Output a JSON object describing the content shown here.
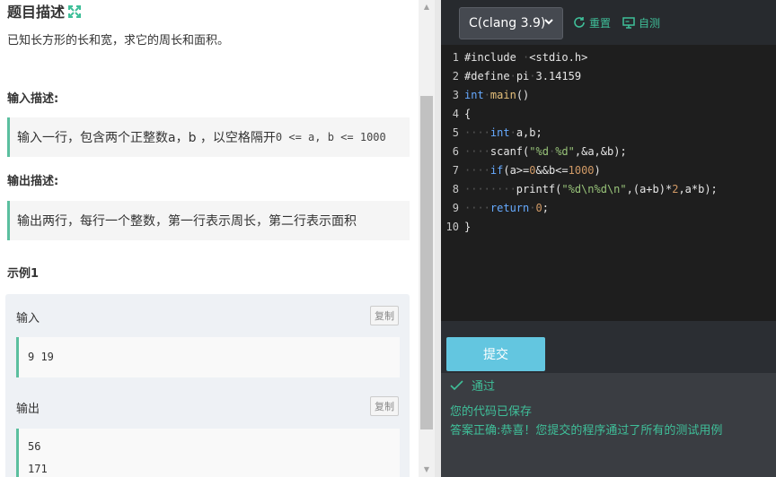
{
  "problem": {
    "title": "题目描述",
    "description": "已知长方形的长和宽，求它的周长和面积。",
    "input_heading": "输入描述:",
    "input_desc_prefix": "输入一行，包含两个正整数a，b ，以空格隔开",
    "input_desc_code": "0 <= a, b <= 1000",
    "output_heading": "输出描述:",
    "output_desc": "输出两行，每行一个整数，第一行表示周长，第二行表示面积",
    "example_heading": "示例1",
    "example": {
      "input_label": "输入",
      "output_label": "输出",
      "copy_label": "复制",
      "input_lines": [
        "9 19"
      ],
      "output_lines": [
        "56",
        "171"
      ]
    }
  },
  "editor": {
    "language": "C(clang 3.9)",
    "reset_label": "重置",
    "selftest_label": "自测",
    "line_numbers": [
      "1",
      "2",
      "3",
      "4",
      "5",
      "6",
      "7",
      "8",
      "9",
      "10"
    ],
    "lines": [
      [
        {
          "t": "#include ",
          "c": "txt"
        },
        {
          "t": "·",
          "c": "ws"
        },
        {
          "t": "<stdio.h>",
          "c": "txt"
        }
      ],
      [
        {
          "t": "#define",
          "c": "txt"
        },
        {
          "t": "·",
          "c": "ws"
        },
        {
          "t": "pi",
          "c": "txt"
        },
        {
          "t": "·",
          "c": "ws"
        },
        {
          "t": "3.14159",
          "c": "txt"
        }
      ],
      [
        {
          "t": "int",
          "c": "kw"
        },
        {
          "t": "·",
          "c": "ws"
        },
        {
          "t": "main",
          "c": "fn"
        },
        {
          "t": "()",
          "c": "txt"
        }
      ],
      [
        {
          "t": "{",
          "c": "txt"
        }
      ],
      [
        {
          "t": "····",
          "c": "ws"
        },
        {
          "t": "int",
          "c": "kw"
        },
        {
          "t": "·",
          "c": "ws"
        },
        {
          "t": "a,b;",
          "c": "txt"
        }
      ],
      [
        {
          "t": "····",
          "c": "ws"
        },
        {
          "t": "scanf(",
          "c": "txt"
        },
        {
          "t": "\"%d",
          "c": "str"
        },
        {
          "t": "·",
          "c": "ws"
        },
        {
          "t": "%d\"",
          "c": "str"
        },
        {
          "t": ",&a,&b);",
          "c": "txt"
        }
      ],
      [
        {
          "t": "····",
          "c": "ws"
        },
        {
          "t": "if",
          "c": "kw"
        },
        {
          "t": "(a>=",
          "c": "txt"
        },
        {
          "t": "0",
          "c": "num"
        },
        {
          "t": "&&b<=",
          "c": "txt"
        },
        {
          "t": "1000",
          "c": "num"
        },
        {
          "t": ")",
          "c": "txt"
        }
      ],
      [
        {
          "t": "········",
          "c": "ws"
        },
        {
          "t": "printf(",
          "c": "txt"
        },
        {
          "t": "\"%d\\n%d\\n\"",
          "c": "str"
        },
        {
          "t": ",(a+b)*",
          "c": "txt"
        },
        {
          "t": "2",
          "c": "num"
        },
        {
          "t": ",a*b);",
          "c": "txt"
        }
      ],
      [
        {
          "t": "····",
          "c": "ws"
        },
        {
          "t": "return",
          "c": "kw"
        },
        {
          "t": "·",
          "c": "ws"
        },
        {
          "t": "0",
          "c": "num"
        },
        {
          "t": ";",
          "c": "txt"
        }
      ],
      [
        {
          "t": "}",
          "c": "txt"
        }
      ]
    ]
  },
  "submit_label": "提交",
  "result": {
    "status": "通过",
    "saved": "您的代码已保存",
    "message": "答案正确:恭喜！您提交的程序通过了所有的测试用例"
  },
  "colors": {
    "accent": "#3fbf99",
    "submit": "#63c6e0",
    "editor_bg": "#1e1e1e"
  }
}
